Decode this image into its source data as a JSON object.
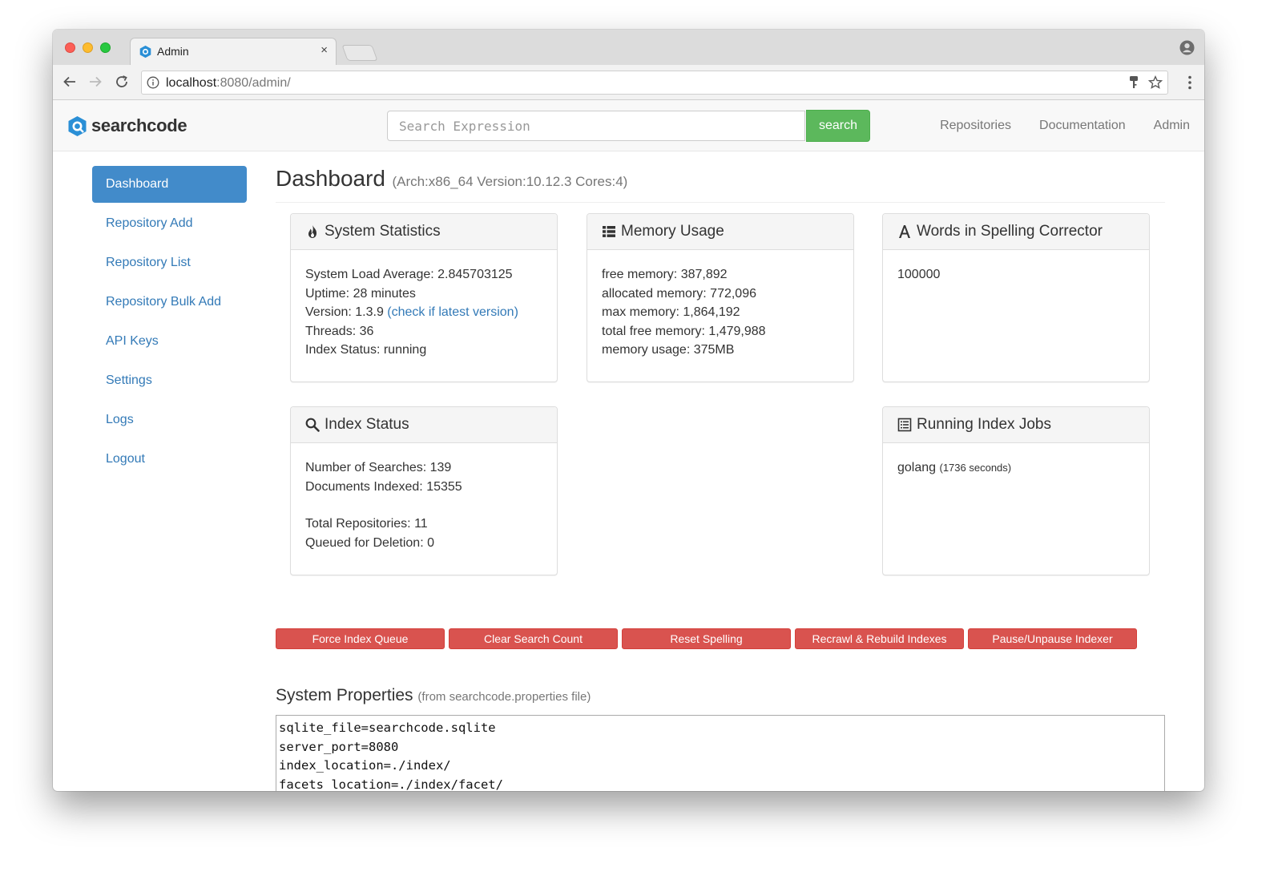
{
  "browser": {
    "tab_title": "Admin",
    "tab_close": "×",
    "url_host": "localhost",
    "url_path": ":8080/admin/"
  },
  "app": {
    "logo_text": "searchcode",
    "search_placeholder": "Search Expression",
    "search_button": "search",
    "nav": [
      "Repositories",
      "Documentation",
      "Admin"
    ]
  },
  "sidebar": {
    "items": [
      {
        "label": "Dashboard",
        "active": true
      },
      {
        "label": "Repository Add"
      },
      {
        "label": "Repository List"
      },
      {
        "label": "Repository Bulk Add"
      },
      {
        "label": "API Keys"
      },
      {
        "label": "Settings"
      },
      {
        "label": "Logs"
      },
      {
        "label": "Logout"
      }
    ]
  },
  "dashboard": {
    "title": "Dashboard",
    "subtitle": "(Arch:x86_64 Version:10.12.3 Cores:4)"
  },
  "panels": {
    "system_statistics": {
      "title": "System Statistics",
      "icon": "fire-icon",
      "load_average": "System Load Average: 2.845703125",
      "uptime": "Uptime: 28 minutes",
      "version_prefix": "Version: 1.3.9",
      "version_link": "(check if latest version)",
      "threads": "Threads: 36",
      "index_status": "Index Status: running"
    },
    "memory_usage": {
      "title": "Memory Usage",
      "icon": "list-icon",
      "lines": [
        "free memory: 387,892",
        "allocated memory: 772,096",
        "max memory: 1,864,192",
        "total free memory: 1,479,988",
        "memory usage: 375MB"
      ]
    },
    "spelling": {
      "title": "Words in Spelling Corrector",
      "icon": "font-icon",
      "value": "100000"
    },
    "index_status": {
      "title": "Index Status",
      "icon": "search-icon",
      "searches": "Number of Searches: 139",
      "documents": "Documents Indexed: 15355",
      "repositories": "Total Repositories: 11",
      "queued": "Queued for Deletion: 0"
    },
    "running_jobs": {
      "title": "Running Index Jobs",
      "icon": "list-alt-icon",
      "job_name": "golang",
      "job_time": "(1736 seconds)"
    }
  },
  "actions": [
    "Force Index Queue",
    "Clear Search Count",
    "Reset Spelling",
    "Recrawl & Rebuild Indexes",
    "Pause/Unpause Indexer"
  ],
  "properties": {
    "title": "System Properties",
    "subtitle": "(from searchcode.properties file)",
    "content": "sqlite_file=searchcode.sqlite\nserver_port=8080\nindex_location=./index/\nfacets_location=./index/facet/\nrepository_location=./repo/\ntrash_location=./trash/"
  },
  "colors": {
    "primary": "#428bca",
    "link": "#337ab7",
    "success": "#5cb85c",
    "danger": "#d9534f"
  }
}
